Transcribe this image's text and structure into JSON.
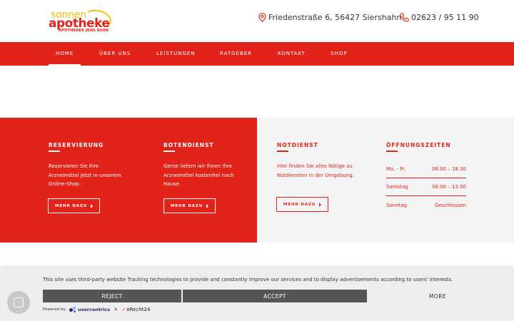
{
  "header": {
    "logo": {
      "line1": "sonnen",
      "line2": "apotheke",
      "line3": "APOTHEKER JENS BURK"
    },
    "address": "Friedenstraße 6, 56427 Siershahn",
    "phone": "02623 / 95 11 90"
  },
  "nav": {
    "items": [
      "HOME",
      "ÜBER UNS",
      "LEISTUNGEN",
      "RATGEBER",
      "KONTAKT",
      "SHOP"
    ],
    "active": "HOME"
  },
  "info": {
    "reservierung": {
      "title": "RESERVIERUNG",
      "text": "Reservieren Sie Ihre Arzneimittel jetzt in unserem Online-Shop.",
      "button": "MEHR DAZU"
    },
    "botendienst": {
      "title": "BOTENDIENST",
      "text": "Gerne liefern wir Ihnen Ihre Arzneimittel kostenfrei nach Hause.",
      "button": "MEHR DAZU"
    },
    "notdienst": {
      "title": "NOTDIENST",
      "text": "Hier finden Sie alles Nötige zu Notdiensten in der Umgebung.",
      "button": "MEHR DAZU"
    },
    "oeffnungszeiten": {
      "title": "ÖFFNUNGSZEITEN",
      "rows": [
        {
          "day": "Mo. - Fr.",
          "time": "08.00 – 18.30"
        },
        {
          "day": "Samstag",
          "time": "08.00 – 13.00"
        },
        {
          "day": "Sonntag",
          "time": "Geschlossen"
        }
      ]
    }
  },
  "consent": {
    "text": "This site uses third-party website Tracking technologies to provide and constantly improve our services and to display advertisements according to users' interests.",
    "reject": "REJECT",
    "accept": "ACCEPT",
    "more": "MORE",
    "powered_by": "Powered by",
    "usercentrics": "usercentrics",
    "amp": "&",
    "erecht": "eRecht24"
  },
  "colors": {
    "brand_red": "#e2231a",
    "brand_yellow": "#f3c300",
    "panel_grey": "#f4f4f4",
    "banner_button": "#555555"
  }
}
